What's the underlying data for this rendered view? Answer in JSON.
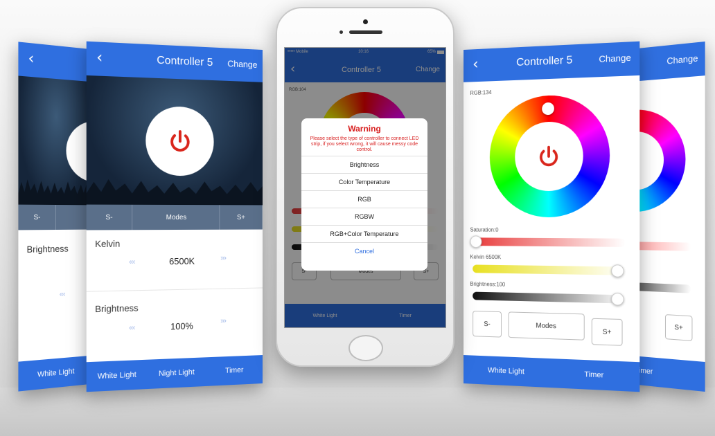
{
  "colors": {
    "accent": "#2f6fe0",
    "power_red": "#d9261c",
    "warning_red": "#d82020"
  },
  "icons": {
    "back": "chevron-left-icon",
    "power": "power-icon"
  },
  "screen1": {
    "back_glyph": "‹",
    "tabs": [
      "S-"
    ],
    "brightness_label": "Brightness",
    "arrows": "‹‹‹",
    "bottom": [
      "White Light"
    ]
  },
  "screen2": {
    "back_glyph": "‹",
    "title": "Controller 5",
    "change": "Change",
    "tabs": [
      "S-",
      "Modes",
      "S+"
    ],
    "kelvin_label": "Kelvin",
    "kelvin_value": "6500K",
    "brightness_label": "Brightness",
    "brightness_value": "100%",
    "arrows_left": "‹‹‹",
    "arrows_right": "›››",
    "bottom": [
      "White Light",
      "Night Light",
      "Timer"
    ]
  },
  "phone": {
    "status_left": "••••• Mobile",
    "status_time": "10:16",
    "status_right": "65%",
    "back_glyph": "‹",
    "title": "Controller 5",
    "change": "Change",
    "rgb_label": "RGB:104",
    "buttons": [
      "S-",
      "Modes",
      "S+"
    ],
    "bottom": [
      "White Light",
      "Timer"
    ],
    "dialog": {
      "title": "Warning",
      "message": "Please select the type of controller to connect LED strip, if you select wrong, it will cause messy code control.",
      "options": [
        "Brightness",
        "Color Temperature",
        "RGB",
        "RGBW",
        "RGB+Color Temperature"
      ],
      "cancel": "Cancel"
    }
  },
  "screen4": {
    "back_glyph": "‹",
    "title": "Controller 5",
    "change": "Change",
    "rgb_label": "RGB:134",
    "saturation_label": "Saturation:0",
    "kelvin_label": "Kelvin 6500K",
    "brightness_label": "Brightness:100",
    "buttons": [
      "S-",
      "Modes",
      "S+"
    ],
    "bottom": [
      "White Light",
      "Timer"
    ]
  },
  "screen5": {
    "change": "Change",
    "button": "S+",
    "bottom": [
      "Timer"
    ]
  }
}
